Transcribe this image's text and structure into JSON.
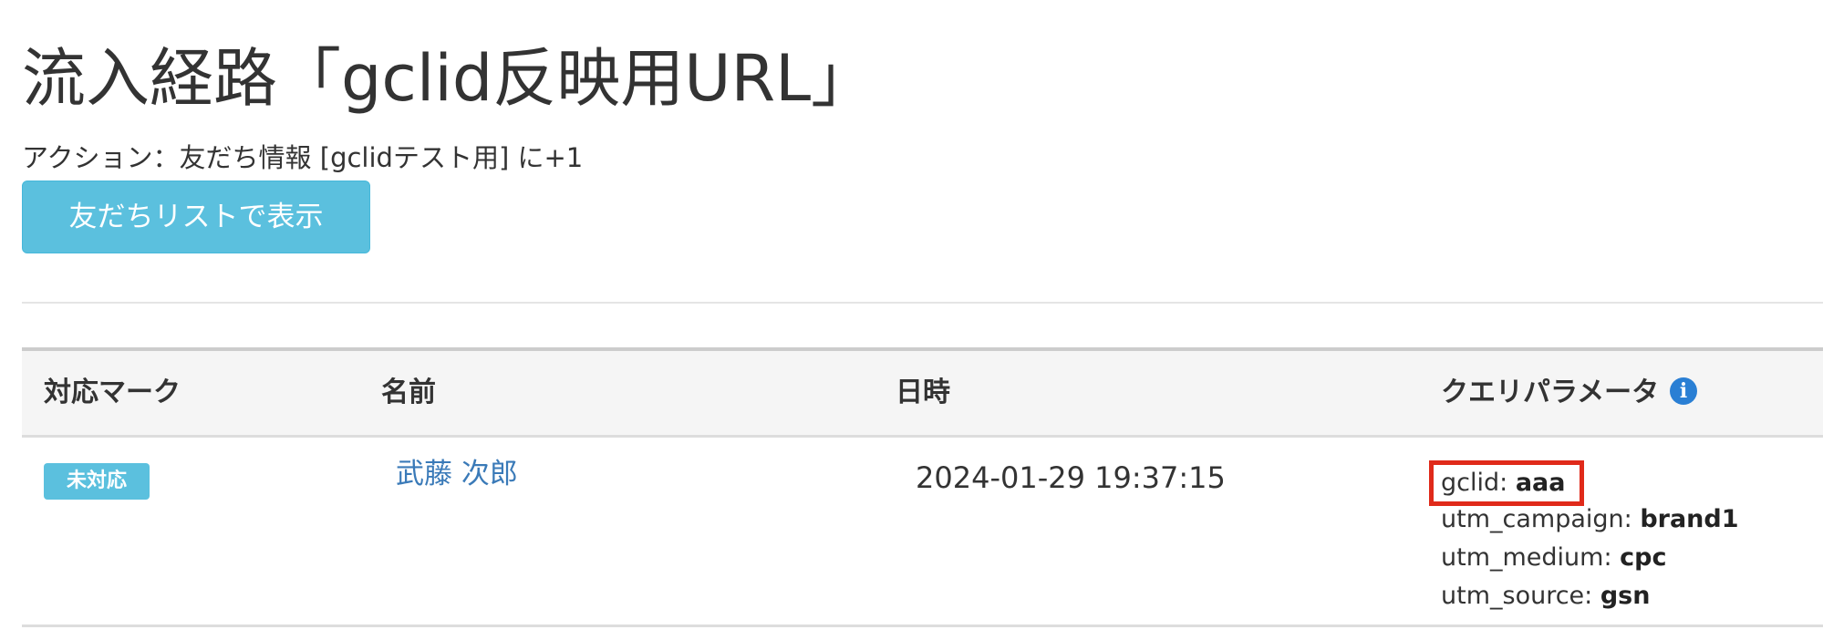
{
  "header": {
    "title": "流入経路「gclid反映用URL」",
    "action_text": "アクション：友だち情報 [gclidテスト用] に+1",
    "friend_list_button": "友だちリストで表示"
  },
  "table": {
    "columns": {
      "mark": "対応マーク",
      "name": "名前",
      "datetime": "日時",
      "query": "クエリパラメータ"
    },
    "rows": [
      {
        "status": "未対応",
        "name": "武藤 次郎",
        "datetime": "2024-01-29 19:37:15",
        "params": [
          {
            "key": "gclid: ",
            "value": "aaa"
          },
          {
            "key": "utm_campaign: ",
            "value": "brand1"
          },
          {
            "key": "utm_medium: ",
            "value": "cpc"
          },
          {
            "key": "utm_source: ",
            "value": "gsn"
          }
        ]
      }
    ]
  },
  "colors": {
    "accent_button": "#5bc0de",
    "link": "#3a7ab8",
    "highlight_box": "#e02a1a",
    "info_icon": "#2a7fd4"
  },
  "icons": {
    "info": "info-icon"
  }
}
